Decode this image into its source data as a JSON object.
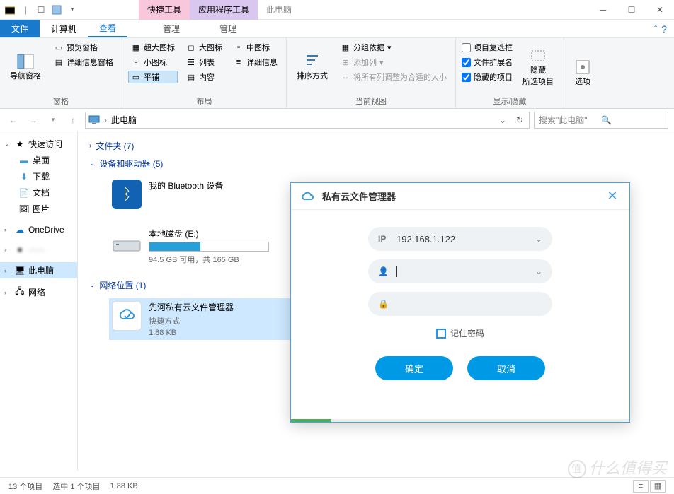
{
  "titlebar": {
    "ctx_tab1": "快捷工具",
    "ctx_tab2": "应用程序工具",
    "title": "此电脑"
  },
  "menubar": {
    "file": "文件",
    "computer": "计算机",
    "view": "查看",
    "manage1": "管理",
    "manage2": "管理"
  },
  "ribbon": {
    "panes": {
      "nav": "导航窗格",
      "preview": "预览窗格",
      "details": "详细信息窗格",
      "group_label": "窗格"
    },
    "layout": {
      "xl": "超大图标",
      "l": "大图标",
      "m": "中图标",
      "s": "小图标",
      "list": "列表",
      "det": "详细信息",
      "tile": "平铺",
      "content": "内容",
      "group_label": "布局"
    },
    "curview": {
      "sort": "排序方式",
      "groupby": "分组依据",
      "addcol": "添加列",
      "fitcol": "将所有列调整为合适的大小",
      "group_label": "当前视图"
    },
    "showhide": {
      "chk1": "项目复选框",
      "chk2": "文件扩展名",
      "chk3": "隐藏的项目",
      "hide": "隐藏\n所选项目",
      "group_label": "显示/隐藏"
    },
    "options": "选项"
  },
  "address": {
    "location": "此电脑",
    "search_placeholder": "搜索\"此电脑\""
  },
  "sidebar": {
    "quick": "快速访问",
    "desktop": "桌面",
    "downloads": "下载",
    "documents": "文档",
    "pictures": "图片",
    "onedrive": "OneDrive",
    "thispc": "此电脑",
    "network": "网络"
  },
  "content": {
    "folders_head": "文件夹 (7)",
    "devices_head": "设备和驱动器 (5)",
    "bt": "我的 Bluetooth 设备",
    "drive_e": "本地磁盘 (E:)",
    "drive_e_sub": "94.5 GB 可用，共 165 GB",
    "netloc_head": "网络位置 (1)",
    "cloud_name": "先河私有云文件管理器",
    "cloud_type": "快捷方式",
    "cloud_size": "1.88 KB"
  },
  "dialog": {
    "title": "私有云文件管理器",
    "ip_label": "IP",
    "ip_value": "192.168.1.122",
    "remember": "记住密码",
    "ok": "确定",
    "cancel": "取消"
  },
  "statusbar": {
    "count": "13 个项目",
    "selected": "选中 1 个项目",
    "size": "1.88 KB"
  },
  "watermark": "什么值得买"
}
